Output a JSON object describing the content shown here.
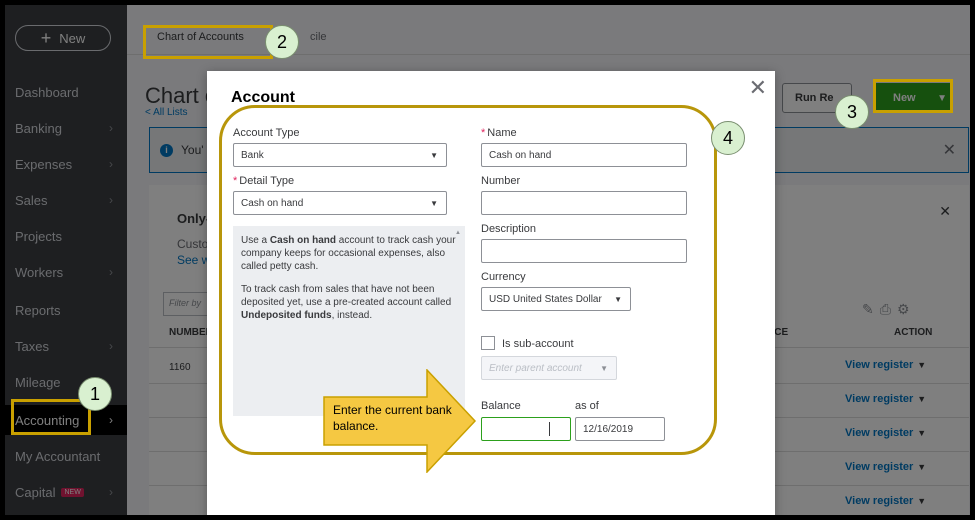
{
  "nav": {
    "new_label": "New",
    "items": [
      {
        "label": "Dashboard",
        "chevron": false
      },
      {
        "label": "Banking",
        "chevron": true
      },
      {
        "label": "Expenses",
        "chevron": true
      },
      {
        "label": "Sales",
        "chevron": true
      },
      {
        "label": "Projects",
        "chevron": false
      },
      {
        "label": "Workers",
        "chevron": true
      },
      {
        "label": "Reports",
        "chevron": false
      },
      {
        "label": "Taxes",
        "chevron": true
      },
      {
        "label": "Mileage",
        "chevron": false
      },
      {
        "label": "Accounting",
        "chevron": true,
        "active": true
      },
      {
        "label": "My Accountant",
        "chevron": false
      },
      {
        "label": "Capital",
        "chevron": true,
        "badge": "NEW"
      }
    ]
  },
  "main": {
    "tabs": [
      "Chart of Accounts",
      "cile"
    ],
    "page_title": "Chart o",
    "all_lists": "< All Lists",
    "run_report": "Run Re",
    "new_button": "New",
    "info_text": "You'",
    "card_heading": "Only-",
    "card_text": "Custo",
    "card_link": "See w",
    "filter_placeholder": "Filter by",
    "col_number": "NUMBER",
    "col_balance": "NCE",
    "col_action": "ACTION",
    "row_number": "1160",
    "view_register": "View register"
  },
  "modal": {
    "title": "Account",
    "account_type_label": "Account Type",
    "account_type_value": "Bank",
    "detail_type_label": "Detail Type",
    "detail_type_value": "Cash on hand",
    "help_p1_a": "Use a ",
    "help_p1_b": "Cash on hand",
    "help_p1_c": " account to track cash your company keeps for occasional expenses, also called petty cash.",
    "help_p2_a": "To track cash from sales that have not been deposited yet, use a pre-created account called ",
    "help_p2_b": "Undeposited funds",
    "help_p2_c": ", instead.",
    "name_label": "Name",
    "name_value": "Cash on hand",
    "number_label": "Number",
    "number_value": "",
    "description_label": "Description",
    "description_value": "",
    "currency_label": "Currency",
    "currency_value": "USD United States Dollar",
    "subaccount_label": "Is sub-account",
    "parent_placeholder": "Enter parent account",
    "balance_label": "Balance",
    "asof_label": "as of",
    "balance_value": "",
    "asof_value": "12/16/2019"
  },
  "annotations": {
    "steps": [
      "1",
      "2",
      "3",
      "4"
    ],
    "callout": "Enter the current bank balance.",
    "highlight_color": "#c9a000",
    "callout_color": "#f5c842"
  }
}
